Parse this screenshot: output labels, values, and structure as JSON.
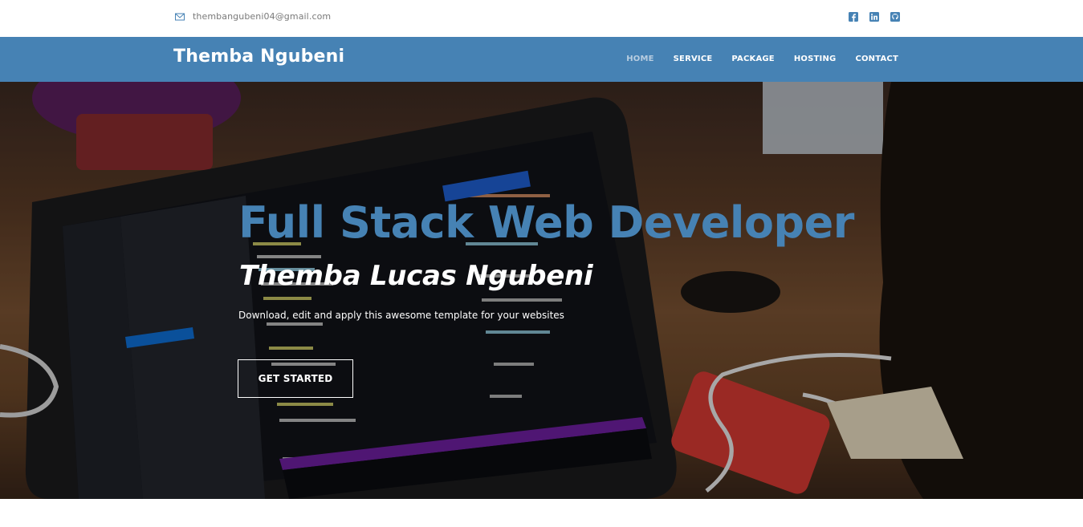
{
  "topbar": {
    "email": "thembangubeni04@gmail.com",
    "email_icon": "envelope-icon",
    "social": [
      {
        "name": "facebook-icon"
      },
      {
        "name": "linkedin-icon"
      },
      {
        "name": "github-icon"
      }
    ]
  },
  "nav": {
    "brand": "Themba Ngubeni",
    "items": [
      {
        "label": "HOME",
        "active": true
      },
      {
        "label": "SERVICE",
        "active": false
      },
      {
        "label": "PACKAGE",
        "active": false
      },
      {
        "label": "HOSTING",
        "active": false
      },
      {
        "label": "CONTACT",
        "active": false
      }
    ]
  },
  "hero": {
    "title": "Full Stack Web Developer",
    "subtitle": "Themba Lucas Ngubeni",
    "description": "Download, edit and apply this awesome template for your websites",
    "cta_label": "GET STARTED"
  },
  "colors": {
    "brand": "#4682b4",
    "white": "#ffffff",
    "muted_text": "#7a7a7a"
  }
}
